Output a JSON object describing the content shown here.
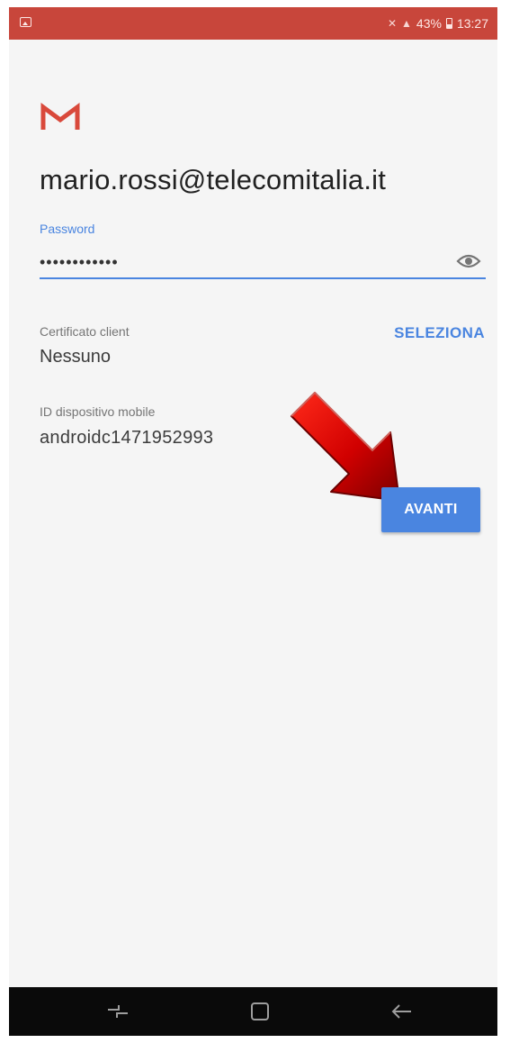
{
  "status_bar": {
    "battery_percent": "43%",
    "time": "13:27"
  },
  "icons": {
    "gallery": "image-thumbnail-icon",
    "mute": "mute-icon",
    "signal": "signal-icon",
    "battery": "battery-icon",
    "gmail": "gmail-logo-icon",
    "visibility": "eye-icon",
    "annotation": "red-arrow-icon",
    "recents": "recent-apps-icon",
    "home": "home-icon",
    "back": "back-icon"
  },
  "account": {
    "email": "mario.rossi@telecomitalia.it"
  },
  "password": {
    "label": "Password",
    "value": "••••••••••••"
  },
  "certificate": {
    "label": "Certificato client",
    "value": "Nessuno",
    "action": "SELEZIONA"
  },
  "device": {
    "label": "ID dispositivo mobile",
    "value": "androidc1471952993"
  },
  "actions": {
    "next_label": "AVANTI"
  },
  "colors": {
    "status_bar": "#c8463b",
    "accent": "#4a85e0",
    "background": "#f5f5f5",
    "annotation_arrow": "#cc0000"
  }
}
